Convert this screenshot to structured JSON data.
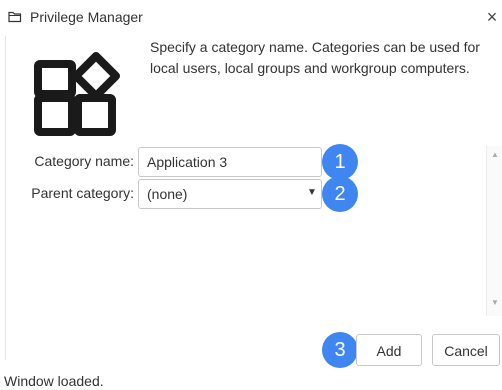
{
  "window": {
    "title": "Privilege Manager",
    "title_icon": "folder-outline-icon",
    "close_glyph": "×"
  },
  "header": {
    "logo_icon": "category-grid-icon",
    "description_lines": [
      "Specify a category name. Categories can be used for",
      "local users, local groups and workgroup computers."
    ]
  },
  "form": {
    "category_name_label": "Category name:",
    "category_name_value": "Application 3",
    "parent_category_label": "Parent category:",
    "parent_category_value": "(none)"
  },
  "callouts": [
    "1",
    "2",
    "3"
  ],
  "buttons": {
    "add_label": "Add",
    "cancel_label": "Cancel"
  },
  "status": {
    "text": "Window loaded."
  },
  "colors": {
    "accent": "#3f86f0",
    "border": "#c8c8c8",
    "text": "#333333",
    "icon": "#1a1a1a"
  }
}
